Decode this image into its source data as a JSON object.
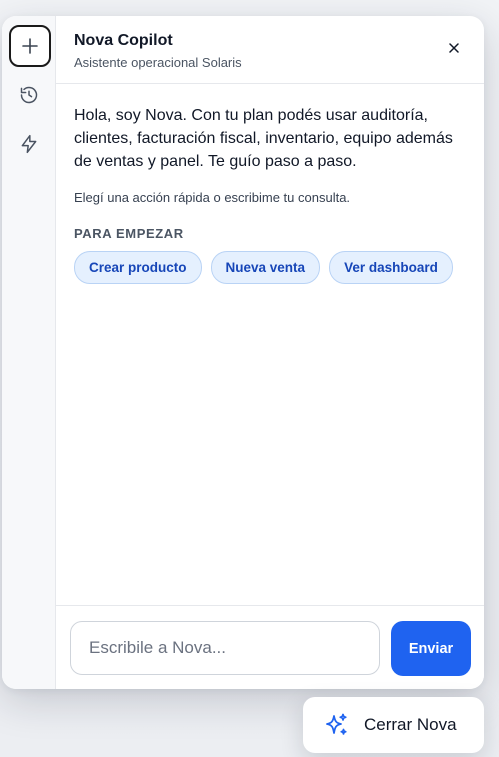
{
  "header": {
    "title": "Nova Copilot",
    "subtitle": "Asistente operacional Solaris"
  },
  "rail": {
    "icons": [
      "plus-icon",
      "history-icon",
      "bolt-icon"
    ]
  },
  "main": {
    "greeting": "Hola, soy Nova. Con tu plan podés usar auditoría, clientes, facturación fiscal, inventario, equipo además de ventas y panel. Te guío paso a paso.",
    "hint": "Elegí una acción rápida o escribime tu consulta.",
    "section_label": "PARA EMPEZAR",
    "quick_actions": [
      {
        "label": "Crear producto"
      },
      {
        "label": "Nueva venta"
      },
      {
        "label": "Ver dashboard"
      }
    ]
  },
  "composer": {
    "placeholder": "Escribile a Nova...",
    "value": "",
    "send_label": "Enviar"
  },
  "fab": {
    "label": "Cerrar Nova",
    "icon": "sparkles-icon"
  },
  "colors": {
    "accent": "#1f63f0",
    "chip_bg": "#e5f0fe",
    "chip_text": "#1746b8"
  }
}
